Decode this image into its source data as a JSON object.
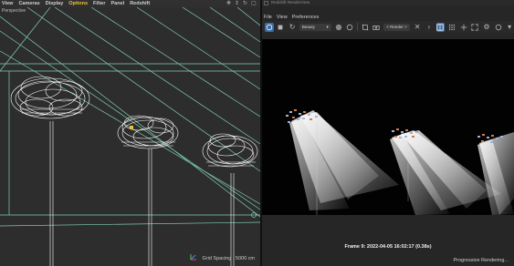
{
  "viewport": {
    "menu": [
      "View",
      "Cameras",
      "Display",
      "Options",
      "Filter",
      "Panel",
      "Redshift"
    ],
    "active_menu": "Options",
    "camera_label": "Perspective",
    "grid_spacing": "Grid Spacing : 5000 cm"
  },
  "renderview": {
    "title": "Redshift RenderView",
    "menu": [
      "File",
      "View",
      "Preferences"
    ],
    "aov_dropdown": "Beauty",
    "render_dropdown": "< Render >",
    "frame_info": "Frame 9:  2022-04-05  16:02:17  (0.38s)",
    "status": "Progressive Rendering..."
  },
  "colors": {
    "accent": "#3b6ea5",
    "active_menu": "#f0c040",
    "grid_lines": "#7fcfb0",
    "wireframe": "#ffffff"
  }
}
